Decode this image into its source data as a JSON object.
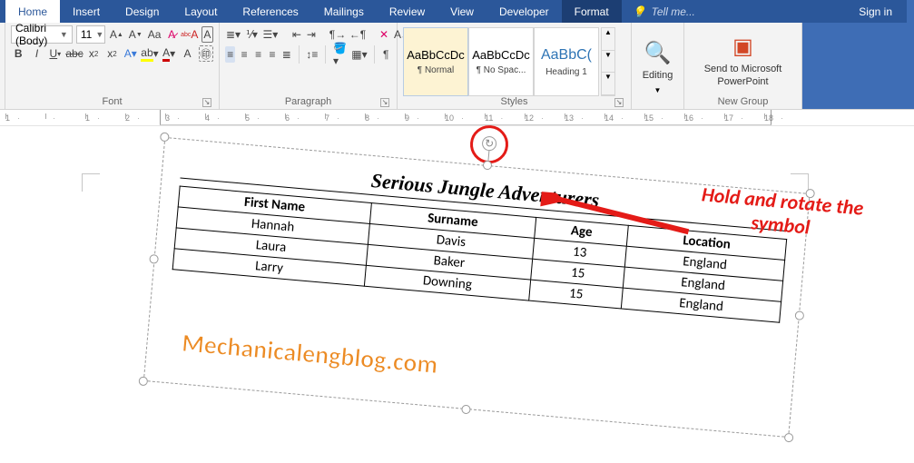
{
  "tabs": {
    "home": "Home",
    "insert": "Insert",
    "design": "Design",
    "layout": "Layout",
    "references": "References",
    "mailings": "Mailings",
    "review": "Review",
    "view": "View",
    "developer": "Developer",
    "format": "Format",
    "tellme": "Tell me...",
    "signin": "Sign in"
  },
  "font": {
    "name": "Calibri (Body)",
    "size": "11",
    "group_label": "Font"
  },
  "paragraph": {
    "group_label": "Paragraph"
  },
  "styles": {
    "group_label": "Styles",
    "tiles": {
      "normal": {
        "preview": "AaBbCcDc",
        "name": "¶ Normal"
      },
      "nospac": {
        "preview": "AaBbCcDc",
        "name": "¶ No Spac..."
      },
      "heading1": {
        "preview": "AaBbC(",
        "name": "Heading 1"
      }
    }
  },
  "editing": {
    "label": "Editing"
  },
  "newgroup": {
    "send_label": "Send to Microsoft PowerPoint",
    "group_label": "New Group"
  },
  "ruler": [
    "1",
    "",
    "1",
    "2",
    "3",
    "4",
    "5",
    "6",
    "7",
    "8",
    "9",
    "10",
    "11",
    "12",
    "13",
    "14",
    "15",
    "16",
    "17",
    "18"
  ],
  "textbox": {
    "title": "Serious Jungle Adventurers",
    "headers": [
      "First Name",
      "Surname",
      "Age",
      "Location"
    ],
    "rows": [
      [
        "Hannah",
        "Davis",
        "13",
        "England"
      ],
      [
        "Laura",
        "Baker",
        "15",
        "England"
      ],
      [
        "Larry",
        "Downing",
        "15",
        "England"
      ]
    ]
  },
  "annotation": "Hold and rotate the symbol",
  "watermark": "Mechanicalengblog.com",
  "chart_data": {
    "type": "table",
    "title": "Serious Jungle Adventurers",
    "headers": [
      "First Name",
      "Surname",
      "Age",
      "Location"
    ],
    "rows": [
      [
        "Hannah",
        "Davis",
        "13",
        "England"
      ],
      [
        "Laura",
        "Baker",
        "15",
        "England"
      ],
      [
        "Larry",
        "Downing",
        "15",
        "England"
      ]
    ]
  }
}
